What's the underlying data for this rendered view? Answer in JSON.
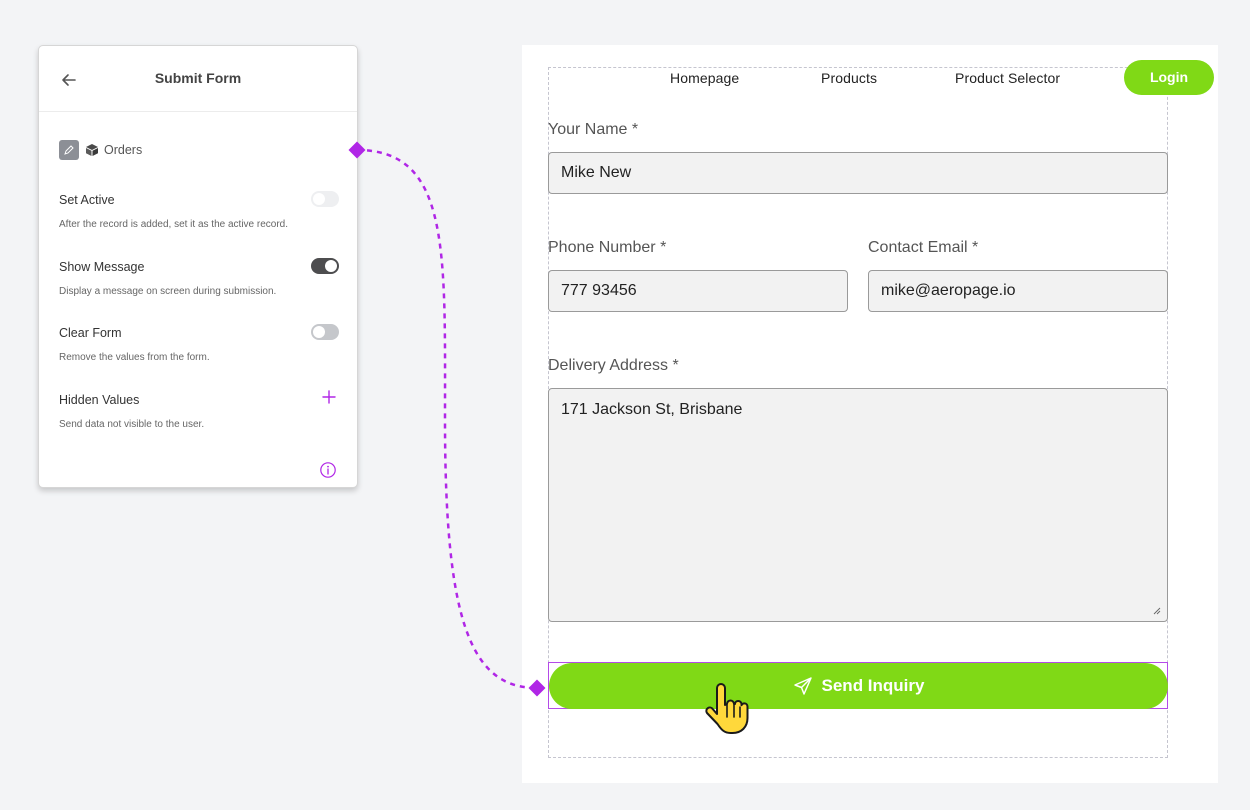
{
  "panel": {
    "title": "Submit Form",
    "back_icon": "arrow-left-icon",
    "source": {
      "label": "Orders",
      "edit_icon": "pencil-icon",
      "table_icon": "cube-icon"
    },
    "settings": [
      {
        "label": "Set Active",
        "description": "After the record is added, set it as the active record.",
        "toggle": false
      },
      {
        "label": "Show Message",
        "description": "Display a message on screen during submission.",
        "toggle": true
      },
      {
        "label": "Clear Form",
        "description": "Remove the values from the form.",
        "toggle": false
      },
      {
        "label": "Hidden Values",
        "description": "Send data not visible to the user.",
        "action_icon": "plus-icon"
      }
    ],
    "info_icon": "info-icon",
    "accent_color": "#b026e6"
  },
  "preview": {
    "nav": [
      "Homepage",
      "Products",
      "Product Selector"
    ],
    "login_label": "Login",
    "brand_color": "#80d916",
    "form": {
      "name": {
        "label": "Your Name *",
        "value": "Mike New"
      },
      "phone": {
        "label": "Phone Number *",
        "value": "777 93456"
      },
      "email": {
        "label": "Contact Email *",
        "value": "mike@aeropage.io"
      },
      "address": {
        "label": "Delivery Address *",
        "value": "171 Jackson St, Brisbane"
      },
      "submit_label": "Send Inquiry",
      "submit_icon": "paper-plane-icon"
    },
    "cursor_icon": "hand-pointer-icon"
  }
}
